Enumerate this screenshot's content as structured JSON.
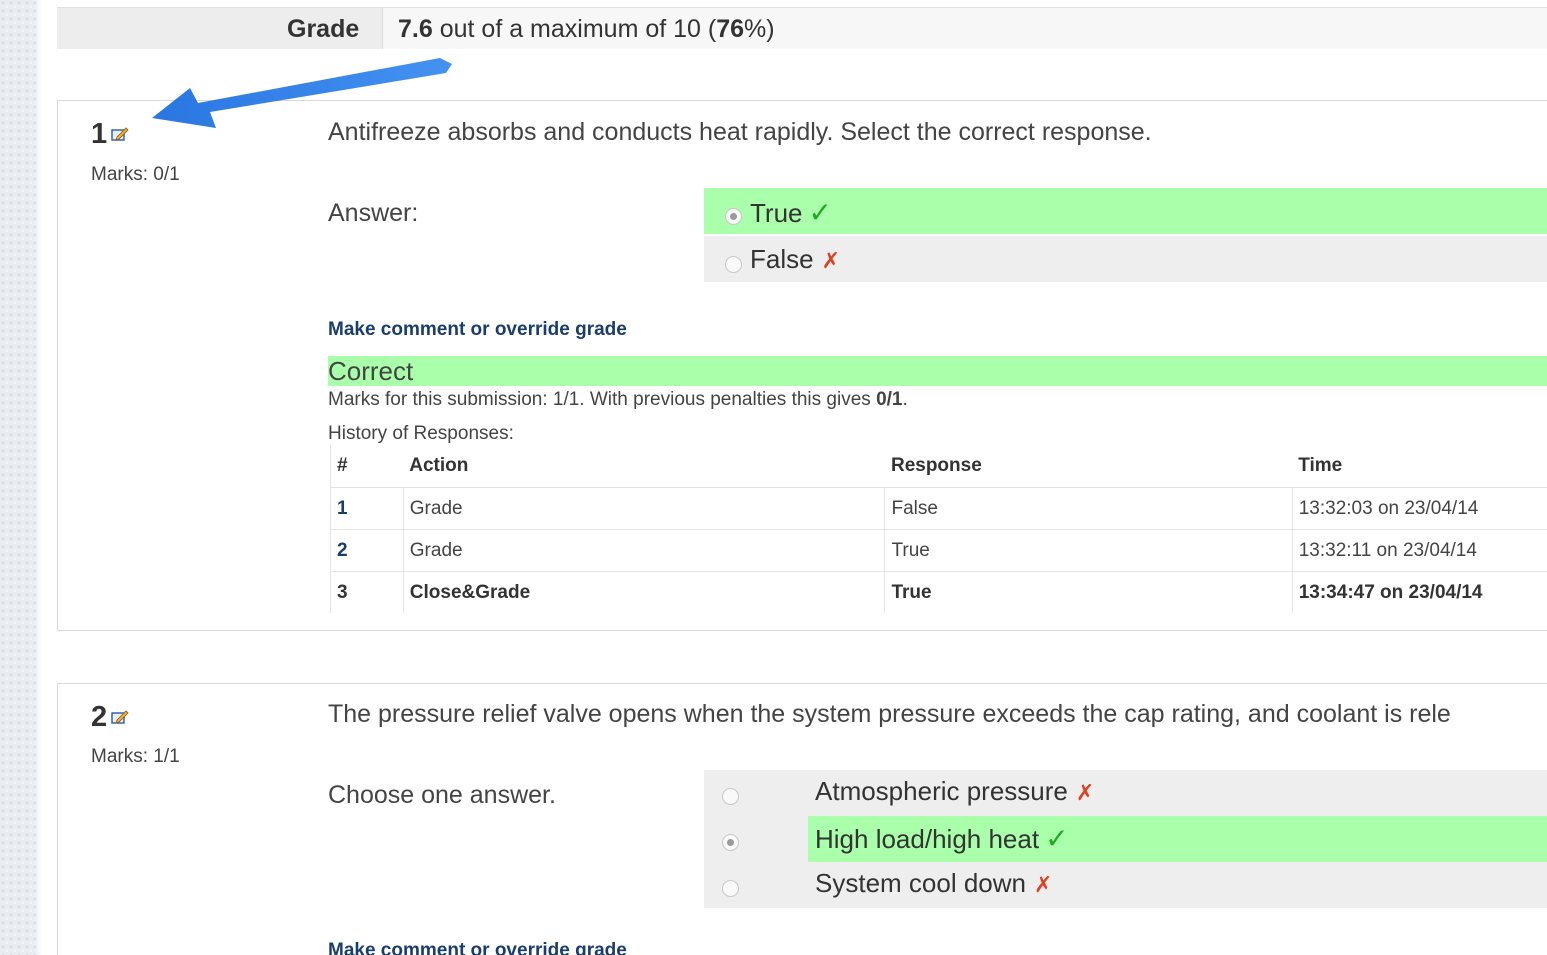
{
  "grade": {
    "label": "Grade",
    "score": "7.6",
    "text_mid": " out of a maximum of 10 (",
    "percent": "76",
    "text_end": "%)"
  },
  "questions": [
    {
      "number": "1",
      "marks": "Marks: 0/1",
      "text": "Antifreeze absorbs and conducts heat rapidly. Select the correct response.",
      "answer_label": "Answer:",
      "options": [
        {
          "label": "True",
          "selected": true,
          "correct": true
        },
        {
          "label": "False",
          "selected": false,
          "correct": false
        }
      ],
      "comment_link": "Make comment or override grade",
      "feedback": "Correct",
      "submission_text": "Marks for this submission: 1/1. With previous penalties this gives ",
      "submission_score": "0/1",
      "submission_end": ".",
      "history_label": "History of Responses:",
      "history": {
        "headers": [
          "#",
          "Action",
          "Response",
          "Time"
        ],
        "rows": [
          {
            "num": "1",
            "action": "Grade",
            "response": "False",
            "time": "13:32:03 on 23/04/14"
          },
          {
            "num": "2",
            "action": "Grade",
            "response": "True",
            "time": "13:32:11 on 23/04/14"
          },
          {
            "num": "3",
            "action": "Close&Grade",
            "response": "True",
            "time": "13:34:47 on 23/04/14"
          }
        ]
      }
    },
    {
      "number": "2",
      "marks": "Marks: 1/1",
      "text": "The pressure relief valve opens when the system pressure exceeds the cap rating, and coolant is rele",
      "answer_label": "Choose one answer.",
      "options": [
        {
          "label": "Atmospheric pressure",
          "selected": false,
          "correct": false
        },
        {
          "label": "High load/high heat",
          "selected": true,
          "correct": true
        },
        {
          "label": "System cool down",
          "selected": false,
          "correct": false
        }
      ],
      "comment_link": "Make comment or override grade"
    }
  ],
  "marks": {
    "tick": "✓",
    "cross": "✗"
  },
  "colors": {
    "correct_bg": "#aaffaa",
    "option_bg": "#eeeeee",
    "link": "#1a3d6e",
    "arrow": "#2f7be0"
  },
  "icons": {
    "edit": "edit-icon"
  }
}
